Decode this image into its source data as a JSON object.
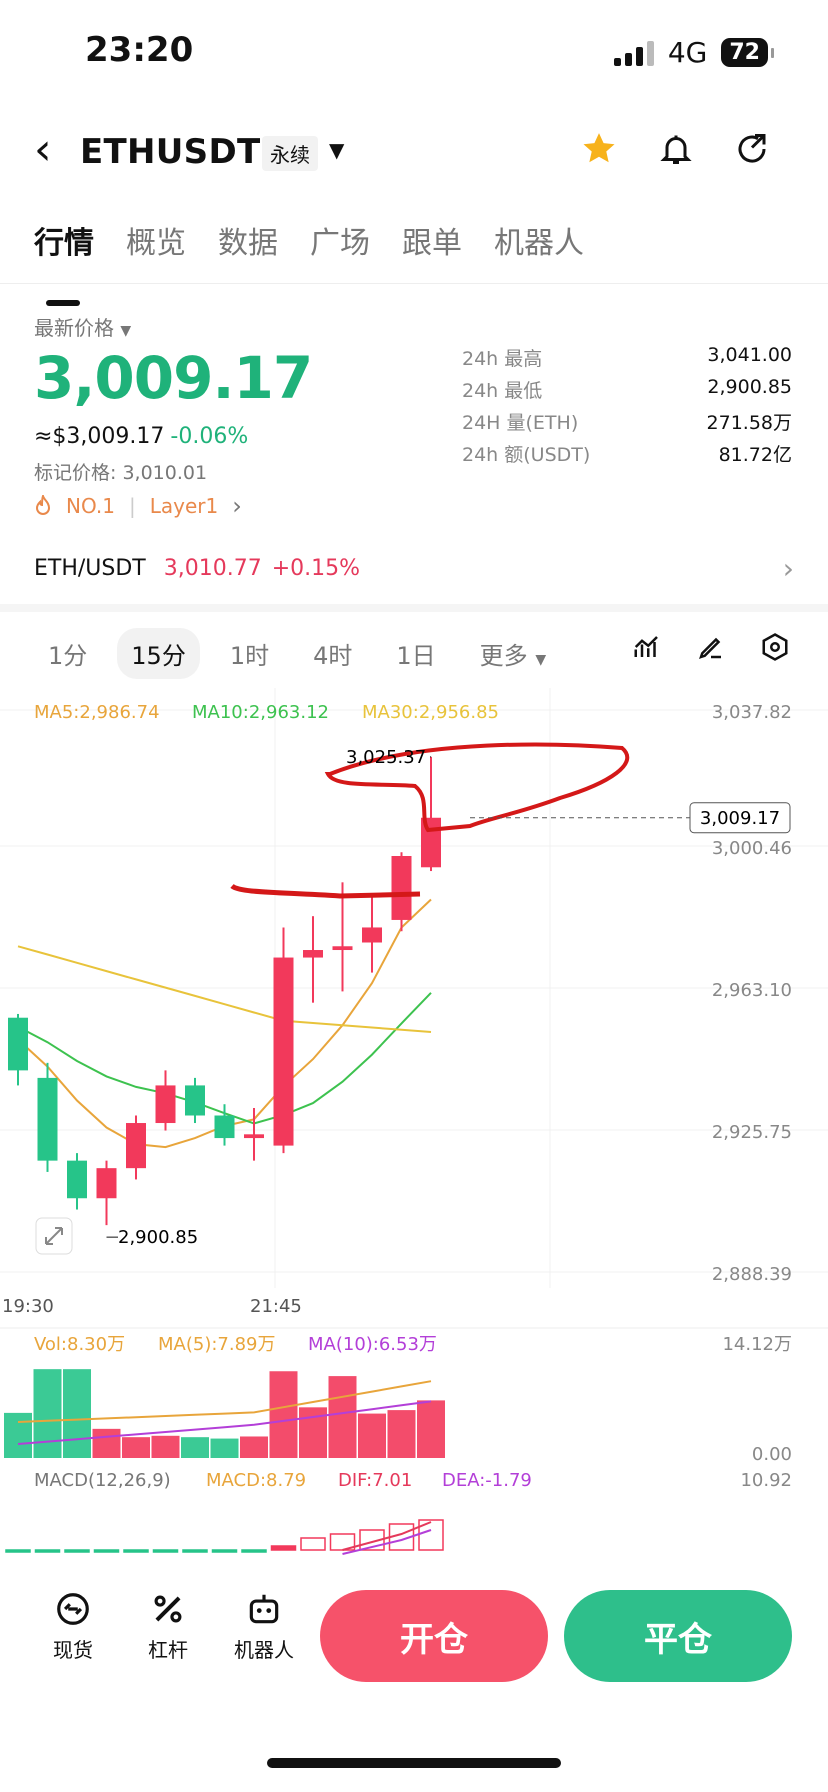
{
  "status": {
    "time": "23:20",
    "network": "4G",
    "battery": "72"
  },
  "header": {
    "pair": "ETHUSDT",
    "contract_type": "永续"
  },
  "tabs": [
    "行情",
    "概览",
    "数据",
    "广场",
    "跟单",
    "机器人"
  ],
  "price_panel": {
    "latest_label": "最新价格",
    "price": "3,009.17",
    "usd_value": "≈$3,009.17",
    "change": "-0.06%",
    "mark_price": "标记价格: 3,010.01",
    "rank_tag": "NO.1",
    "category_tag": "Layer1"
  },
  "stats": [
    {
      "label": "24h  最高",
      "value": "3,041.00"
    },
    {
      "label": "24h  最低",
      "value": "2,900.85"
    },
    {
      "label": "24H  量(ETH)",
      "value": "271.58万"
    },
    {
      "label": "24h  额(USDT)",
      "value": "81.72亿"
    }
  ],
  "spot": {
    "pair": "ETH/USDT",
    "price": "3,010.77",
    "change": "+0.15%"
  },
  "timeframes": [
    "1分",
    "15分",
    "1时",
    "4时",
    "1日",
    "更多"
  ],
  "active_timeframe": "15分",
  "chart_data": {
    "type": "candlestick",
    "ma_labels": [
      "MA5:2,986.74",
      "MA10:2,963.12",
      "MA30:2,956.85"
    ],
    "ma_colors": [
      "#e8a53b",
      "#3dc24f",
      "#e8c33b"
    ],
    "y_ticks": [
      "3,037.82",
      "3,000.46",
      "2,963.10",
      "2,925.75",
      "2,888.39"
    ],
    "ylim": [
      2888.39,
      3037.82
    ],
    "x_ticks": [
      "19:30",
      "21:45"
    ],
    "current_price_label": "3,009.17",
    "high_marker": "3,025.37",
    "low_marker": "2,900.85",
    "candles": [
      {
        "o": 2956,
        "h": 2957,
        "l": 2938,
        "c": 2942
      },
      {
        "o": 2940,
        "h": 2944,
        "l": 2915,
        "c": 2918
      },
      {
        "o": 2918,
        "h": 2920,
        "l": 2905,
        "c": 2908
      },
      {
        "o": 2908,
        "h": 2918,
        "l": 2900.85,
        "c": 2916
      },
      {
        "o": 2916,
        "h": 2930,
        "l": 2913,
        "c": 2928
      },
      {
        "o": 2928,
        "h": 2942,
        "l": 2926,
        "c": 2938
      },
      {
        "o": 2938,
        "h": 2940,
        "l": 2928,
        "c": 2930
      },
      {
        "o": 2930,
        "h": 2933,
        "l": 2922,
        "c": 2924
      },
      {
        "o": 2924,
        "h": 2932,
        "l": 2918,
        "c": 2925
      },
      {
        "o": 2922,
        "h": 2980,
        "l": 2920,
        "c": 2972
      },
      {
        "o": 2972,
        "h": 2983,
        "l": 2960,
        "c": 2974
      },
      {
        "o": 2974,
        "h": 2992,
        "l": 2963,
        "c": 2975
      },
      {
        "o": 2976,
        "h": 2988,
        "l": 2968,
        "c": 2980
      },
      {
        "o": 2982,
        "h": 3000,
        "l": 2979,
        "c": 2999
      },
      {
        "o": 2996,
        "h": 3025.37,
        "l": 2995,
        "c": 3009.17
      }
    ],
    "volume": {
      "labels": [
        "Vol:8.30万",
        "MA(5):7.89万",
        "MA(10):6.53万"
      ],
      "label_colors": [
        "#e8a53b",
        "#e8a53b",
        "#b33fd8"
      ],
      "max_label": "14.12万",
      "min_label": "0.00",
      "max": 14.12,
      "values": [
        6.5,
        12.8,
        12.8,
        4.2,
        3.0,
        3.2,
        3.0,
        2.8,
        3.1,
        12.5,
        7.3,
        11.8,
        6.4,
        6.9,
        8.3
      ]
    },
    "macd": {
      "labels": [
        "MACD(12,26,9)",
        "MACD:8.79",
        "DIF:7.01",
        "DEA:-1.79"
      ],
      "label_colors": [
        "#777777",
        "#e8a53b",
        "#e5395b",
        "#b33fd8"
      ],
      "max_label": "10.92"
    }
  },
  "bottom_nav": [
    {
      "label": "现货",
      "icon": "spot-icon"
    },
    {
      "label": "杠杆",
      "icon": "leverage-icon"
    },
    {
      "label": "机器人",
      "icon": "robot-icon"
    }
  ],
  "actions": {
    "open": "开仓",
    "close": "平仓"
  }
}
